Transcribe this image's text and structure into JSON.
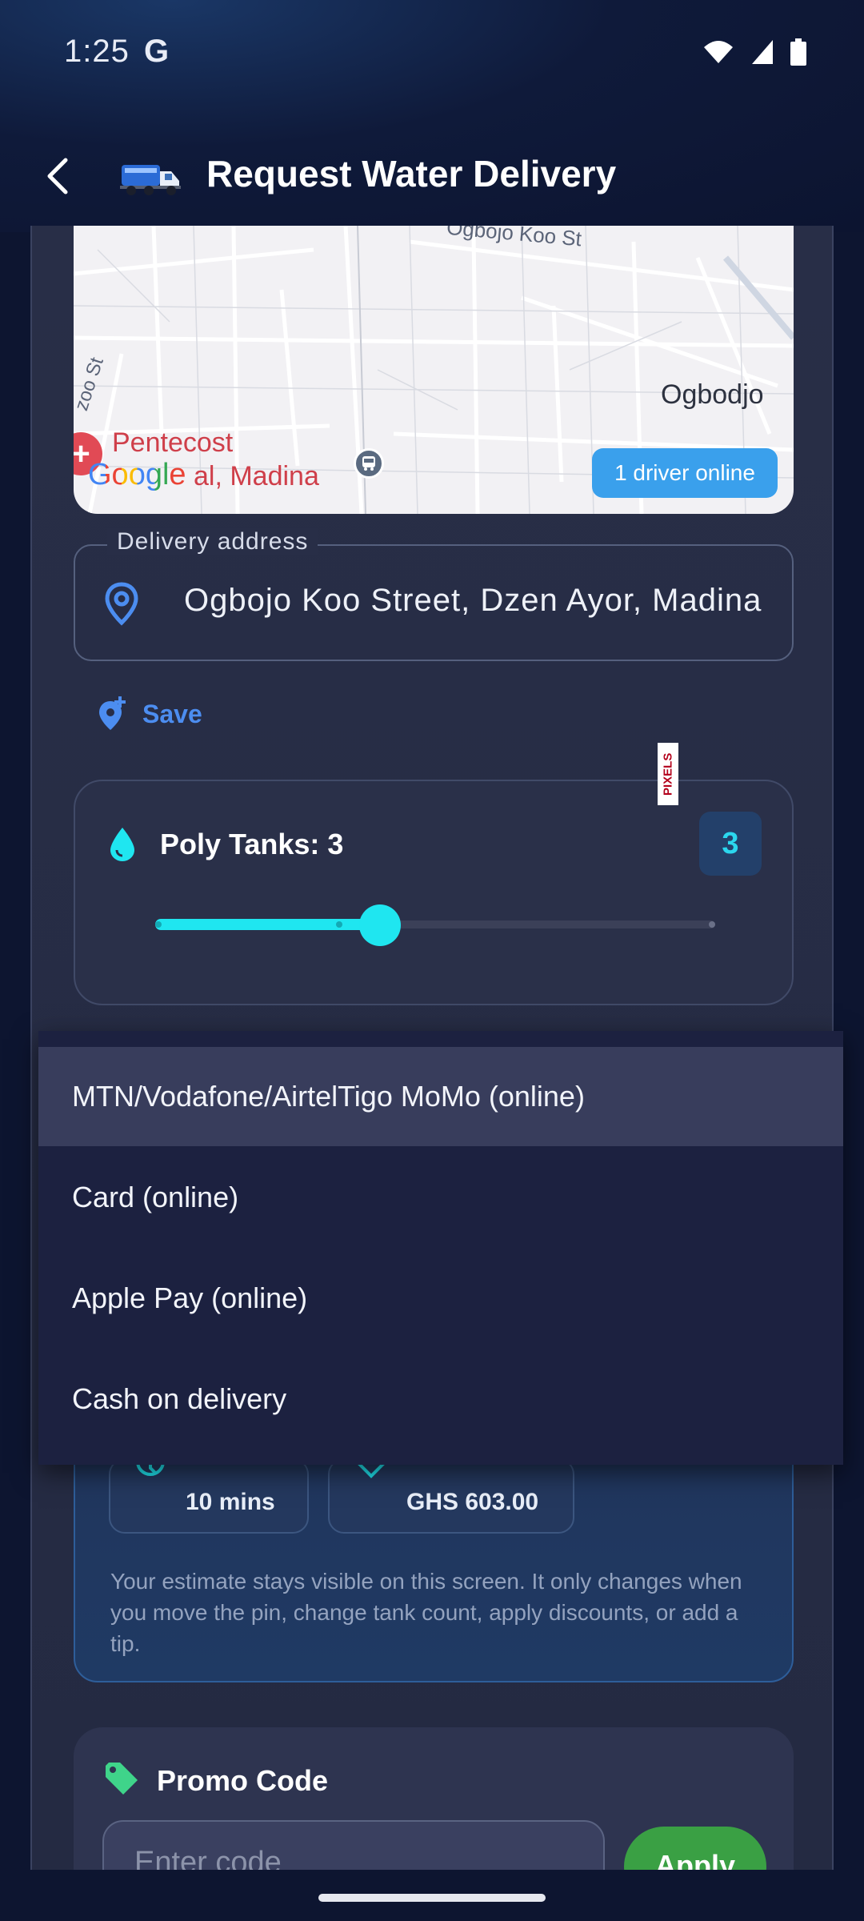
{
  "status_bar": {
    "time": "1:25",
    "g_badge": "G",
    "icons": [
      "wifi-icon",
      "signal-icon",
      "battery-icon"
    ]
  },
  "app_bar": {
    "title": "Request Water Delivery",
    "back_icon": "back-arrow-icon",
    "logo_icon": "water-truck-icon"
  },
  "map": {
    "street_label": "Ogbojo Koo St",
    "area_label": "Ogbodjo",
    "side_street": "zoo St",
    "poi_label_1": "Pentecost",
    "poi_label_2": "al, Madina",
    "google_logo": "Google",
    "drivers_online": "1 driver online"
  },
  "address": {
    "legend": "Delivery address",
    "value": "Ogbojo Koo Street, Dzen Ayor, Madina"
  },
  "save": {
    "label": "Save"
  },
  "tanks": {
    "title": "Poly Tanks: 3",
    "badge": "3",
    "value": 3,
    "min": 1,
    "max": 5
  },
  "pixels_tag": "PIXELS",
  "payment_dropdown": {
    "options": [
      "MTN/Vodafone/AirtelTigo MoMo (online)",
      "Card (online)",
      "Apple Pay (online)",
      "Cash on delivery"
    ],
    "selected_index": 0
  },
  "estimate": {
    "eta": "10 mins",
    "price": "GHS 603.00",
    "note": "Your estimate stays visible on this screen. It only changes when you move the pin, change tank count, apply discounts, or add a tip."
  },
  "promo": {
    "title": "Promo Code",
    "placeholder": "Enter code",
    "apply_label": "Apply"
  },
  "colors": {
    "accent_cyan": "#1fe6f0",
    "save_blue": "#4c8df0",
    "apply_green": "#3aa044",
    "driver_pill": "#3aa0ec",
    "panel": "#282e47"
  }
}
